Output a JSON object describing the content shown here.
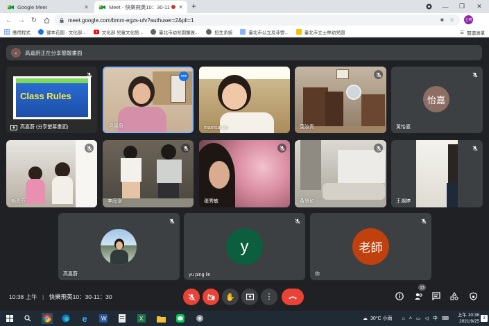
{
  "browser": {
    "tabs": [
      {
        "title": "Google Meet",
        "active": false
      },
      {
        "title": "Meet - 快樂飛英10：30-11：",
        "active": true,
        "recording": true
      }
    ],
    "url": "meet.google.com/bmm-egzs-ufv?authuser=2&pli=1",
    "profile_initial": "士林",
    "bookmarks": [
      {
        "label": "應用程式",
        "icon": "apps-grid-icon"
      },
      {
        "label": "健本花園 - 文化部...",
        "icon": "site-icon"
      },
      {
        "label": "文化部 兒童文化館...",
        "icon": "youtube-icon"
      },
      {
        "label": "臺北市幼兒園擴展...",
        "icon": "globe-icon"
      },
      {
        "label": "招生系統",
        "icon": "globe-icon"
      },
      {
        "label": "臺北市公立及非營...",
        "icon": "building-icon"
      },
      {
        "label": "臺北市立士林幼兒園",
        "icon": "building-icon"
      }
    ],
    "reading_list": "閱讀清單"
  },
  "meet": {
    "presenting_banner": "高嘉蔚正在分享簡報畫面",
    "participants": [
      {
        "name": "高嘉蔚 (分享螢幕畫面)",
        "type": "screen",
        "slide_text": "Class Rules",
        "muted": true
      },
      {
        "name": "高嘉蔚",
        "type": "video",
        "muted": false,
        "speaking": true
      },
      {
        "name": "marrisa Lin",
        "type": "video",
        "muted": false
      },
      {
        "name": "葉汝青",
        "type": "video",
        "muted": true
      },
      {
        "name": "黃怡嘉",
        "type": "avatar",
        "initials": "怡嘉",
        "color": "#8d6e63",
        "muted": true
      },
      {
        "name": "賴盈芬",
        "type": "video",
        "muted": true
      },
      {
        "name": "李品澄",
        "type": "video",
        "muted": true
      },
      {
        "name": "張秀敏",
        "type": "video",
        "muted": true
      },
      {
        "name": "黃慧如",
        "type": "video",
        "muted": true
      },
      {
        "name": "王湘婷",
        "type": "video",
        "muted": true
      },
      {
        "name": "高嘉蔚",
        "type": "photo",
        "muted": true
      },
      {
        "name": "yu ping lin",
        "type": "avatar",
        "initials": "y",
        "color": "#0b5f3f",
        "muted": true
      },
      {
        "name": "你",
        "type": "avatar",
        "initials": "老師",
        "color": "#c0400e",
        "muted": true
      }
    ],
    "time": "10:38 上午",
    "meeting_title": "快樂飛英10：30-11：30",
    "participant_count": "13"
  },
  "taskbar": {
    "weather": "30°C 小雨",
    "ime": "中",
    "time": "上午 10:38",
    "date": "2021/9/25",
    "notification_count": "3"
  }
}
